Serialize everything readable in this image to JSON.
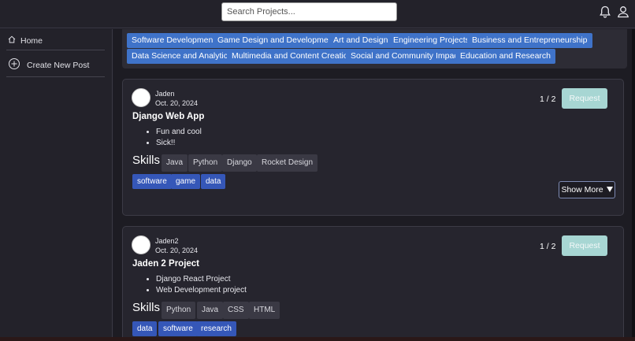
{
  "search": {
    "placeholder": "Search Projects..."
  },
  "header": {
    "bell_icon": "bell-icon",
    "user_icon": "user-icon"
  },
  "sidebar": {
    "items": [
      {
        "label": "Home",
        "icon": "home-icon"
      },
      {
        "label": "Create New Post",
        "icon": "plus-circle-icon"
      }
    ]
  },
  "categories": [
    "Software Development",
    "Game Design and Development",
    "Art and Design",
    "Engineering Projects",
    "Business and Entrepreneurship",
    "Data Science and Analytics",
    "Multimedia and Content Creation",
    "Social and Community Impact",
    "Education and Research"
  ],
  "colors": {
    "category": "#3f73c9",
    "tag": "#3557b8",
    "request": "#a7d6d3"
  },
  "posts": [
    {
      "user": "Jaden",
      "date": "Oct. 20, 2024",
      "title": "Django Web App",
      "bullets": [
        "Fun and cool",
        "Sick!!"
      ],
      "skills_label": "Skills",
      "skills": [
        "Java",
        "Python",
        "Django",
        "Rocket Design"
      ],
      "tags": [
        "software",
        "game",
        "data"
      ],
      "count": "1 / 2",
      "request_label": "Request",
      "show_more_label": "Show More"
    },
    {
      "user": "Jaden2",
      "date": "Oct. 20, 2024",
      "title": "Jaden 2 Project",
      "bullets": [
        "Django React Project",
        "Web Development project"
      ],
      "skills_label": "Skills",
      "skills": [
        "Python",
        "Java",
        "CSS",
        "HTML"
      ],
      "tags": [
        "data",
        "software",
        "research"
      ],
      "count": "1 / 2",
      "request_label": "Request"
    }
  ]
}
